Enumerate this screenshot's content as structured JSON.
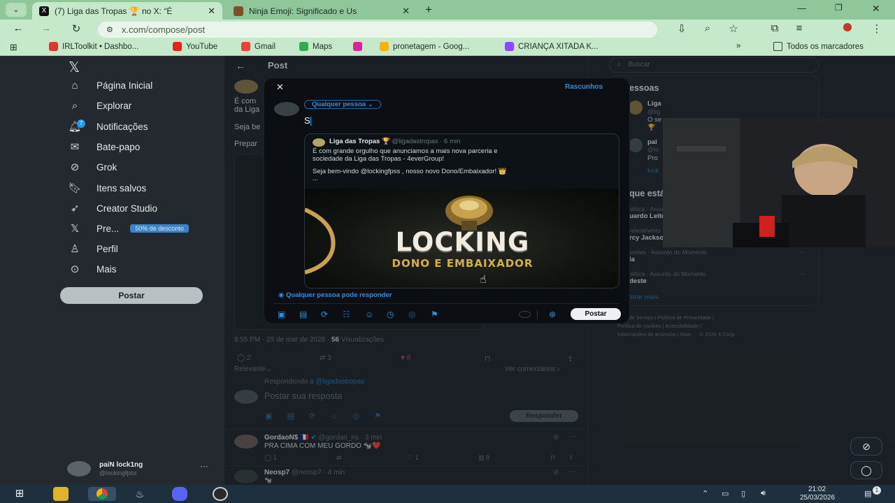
{
  "browser": {
    "tabs": [
      {
        "title": "(7) Liga das Tropas 🏆 no X: “É",
        "active": true
      },
      {
        "title": "Ninja Emoji: Significado e Us",
        "active": false
      }
    ],
    "url": "x.com/compose/post",
    "bookmarks": [
      "IRLToolkit • Dashbo...",
      "YouTube",
      "Gmail",
      "Maps",
      "pronetagem - Goog...",
      "CRIANÇA XITADA K..."
    ],
    "bookmarks_overflow": "»",
    "all_bookmarks": "Todos os marcadores"
  },
  "nav": {
    "items": [
      "Página Inicial",
      "Explorar",
      "Notificações",
      "Bate-papo",
      "Grok",
      "Itens salvos",
      "Creator Studio",
      "Pre...",
      "Perfil",
      "Mais"
    ],
    "premium_badge": "50% de desconto",
    "notification_count": "7",
    "post_button": "Postar",
    "account_name": "paiN lock1ng",
    "account_handle": "@lockingfpss",
    "more_dots": "···"
  },
  "center": {
    "header_back": "←",
    "header_title": "Post",
    "line1": "É com",
    "line2": "da Liga",
    "line3": "Seja be",
    "line4": "Prepar",
    "time": "8:55 PM · 25 de mar de 2026 ·",
    "views_count": "56",
    "views_label": "Visualizações",
    "replies": "2",
    "reposts": "3",
    "likes": "8",
    "relevant": "Relevante",
    "see_comments": "Ver comentários ›",
    "replying_to": "Respondendo a",
    "replying_handle": "@ligadastropas",
    "reply_placeholder": "Postar sua resposta",
    "reply_button": "Responder",
    "comments": [
      {
        "name": "GordaoN$",
        "flag": "🇫🇷",
        "handle": "@gordao_ns · 3 min",
        "text": "PRA CIMA COM MEU GORDO 🐄❤️",
        "r": "1",
        "l": "1",
        "v": "8"
      },
      {
        "name": "Neosp7",
        "flag": "",
        "handle": "@neosp7 · 4 min",
        "text": "🐄",
        "r": "",
        "l": "",
        "v": ""
      }
    ]
  },
  "right": {
    "search_placeholder": "Buscar",
    "section_partial": "essoas",
    "who1": "Liga",
    "who1_sub": "@lig",
    "who1_desc": "O se",
    "who2": "pai",
    "who2_sub": "@lo",
    "who2_desc": "Pro",
    "who2_desc2": "kick",
    "trending_title": "que está acontecendo",
    "trends": [
      {
        "cat": "olítica · Assunto do Momento",
        "name": "uardo Leite"
      },
      {
        "cat": "retenimento · Assunto do Momento",
        "name": "rcy Jackson"
      },
      {
        "cat": "portes · Assunto do Momento",
        "name": "la"
      },
      {
        "cat": "olítica · Assunto do Momento",
        "name": "deste"
      }
    ],
    "show_more": "strar mais",
    "footer1": "mos de Serviço  |  Política de Privacidade  |",
    "footer2": "Política de cookies  |  Acessibilidade  |",
    "footer3": "Informações de anúncios  |  Mais ···  © 2026 X Corp."
  },
  "modal": {
    "close": "✕",
    "drafts": "Rascunhos",
    "audience": "Qualquer pessoa",
    "typed_text": "S",
    "quote_name": "Liga das Tropas 🏆",
    "quote_handle": "@ligadastropas · 6 min",
    "quote_line1": "É com grande orgulho que anunciamos a mais nova parceria e",
    "quote_line2": "sociedade da Liga das Tropas - 4everGroup!",
    "quote_line3": "Seja bem-vindo @lockingfpss , nosso novo Dono/Embaixador! 👑",
    "quote_more": "...",
    "promo_title": "LOCKING",
    "promo_sub": "DONO E EMBAIXADOR",
    "reply_setting": "Qualquer pessoa pode responder",
    "post_button": "Postar"
  },
  "taskbar": {
    "time": "21:02",
    "date": "25/03/2026",
    "notif": "1"
  },
  "colors": {
    "accent": "#1d9bf0",
    "chrome": "#c6e8cb",
    "x_bg": "#23292e",
    "modal_bg": "#0b0f13",
    "like": "#f91880"
  }
}
